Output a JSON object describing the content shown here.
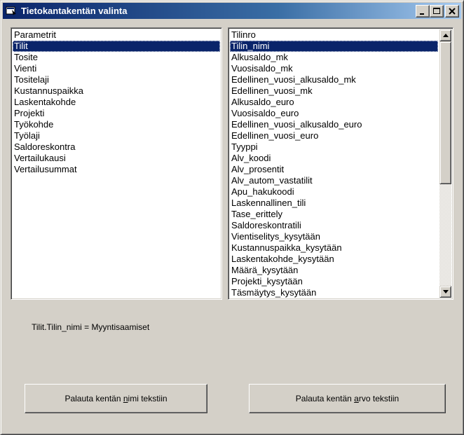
{
  "window": {
    "title": "Tietokantakentän valinta"
  },
  "tables_list": {
    "selected_index": 1,
    "items": [
      "Parametrit",
      "Tilit",
      "Tosite",
      "Vienti",
      "Tositelaji",
      "Kustannuspaikka",
      "Laskentakohde",
      "Projekti",
      "Työkohde",
      "Työlaji",
      "Saldoreskontra",
      "Vertailukausi",
      "Vertailusummat"
    ]
  },
  "fields_list": {
    "selected_index": 1,
    "items": [
      "Tilinro",
      "Tilin_nimi",
      "Alkusaldo_mk",
      "Vuosisaldo_mk",
      "Edellinen_vuosi_alkusaldo_mk",
      "Edellinen_vuosi_mk",
      "Alkusaldo_euro",
      "Vuosisaldo_euro",
      "Edellinen_vuosi_alkusaldo_euro",
      "Edellinen_vuosi_euro",
      "Tyyppi",
      "Alv_koodi",
      "Alv_prosentit",
      "Alv_autom_vastatilit",
      "Apu_hakukoodi",
      "Laskennallinen_tili",
      "Tase_erittely",
      "Saldoreskontratili",
      "Vientiselitys_kysytään",
      "Kustannuspaikka_kysytään",
      "Laskentakohde_kysytään",
      "Määrä_kysytään",
      "Projekti_kysytään",
      "Täsmäytys_kysytään"
    ]
  },
  "status": {
    "text": "Tilit.Tilin_nimi = Myyntisaamiset"
  },
  "buttons": {
    "name_to_text": {
      "pre": "Palauta kentän ",
      "key": "n",
      "post": "imi tekstiin"
    },
    "value_to_text": {
      "pre": "Palauta kentän ",
      "key": "a",
      "post": "rvo tekstiin"
    }
  }
}
